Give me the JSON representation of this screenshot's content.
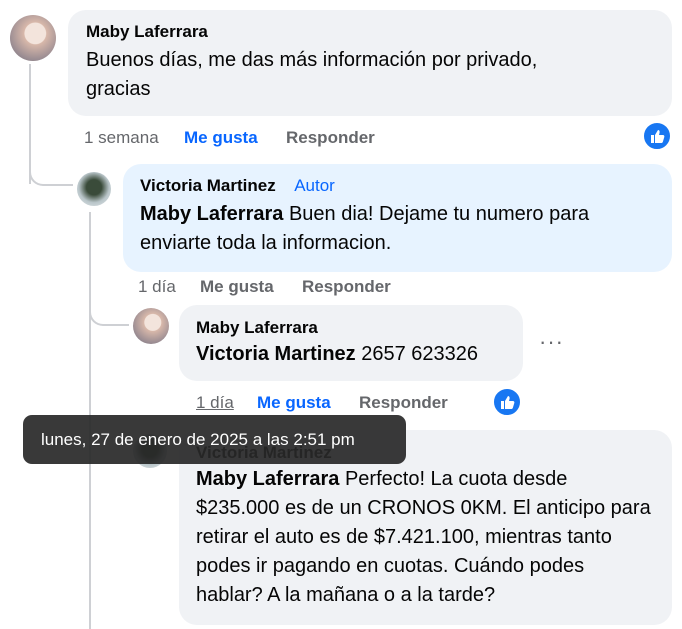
{
  "comments": [
    {
      "author": "Maby Laferrara",
      "text": "Buenos días, me das más información por privado, gracias",
      "time": "1 semana",
      "like": "Me gusta",
      "reply": "Responder"
    },
    {
      "author": "Victoria Martinez",
      "badge": "Autor",
      "mention": "Maby Laferrara",
      "text": " Buen dia! Dejame tu numero para enviarte toda la informacion.",
      "time": "1 día",
      "like": "Me gusta",
      "reply": "Responder"
    },
    {
      "author": "Maby Laferrara",
      "mention": "Victoria Martinez",
      "text": " 2657 623326",
      "time": "1 día",
      "like": "Me gusta",
      "reply": "Responder"
    },
    {
      "author": "Victoria Martinez",
      "mention": "Maby Laferrara",
      "text": " Perfecto! La cuota desde $235.000 es de un CRONOS 0KM. El anticipo para retirar el auto es de $7.421.100, mientras tanto podes ir pagando en cuotas. Cuándo podes hablar? A la mañana o a la tarde?"
    }
  ],
  "tooltip": "lunes, 27 de enero de 2025 a las 2:51 pm",
  "icons": {
    "like": "thumbs-up-icon",
    "more": "more-options-icon"
  },
  "colors": {
    "accent": "#0866ff",
    "bubble": "#f0f2f5",
    "author_bubble": "#e7f3ff",
    "tooltip": "#282828"
  }
}
